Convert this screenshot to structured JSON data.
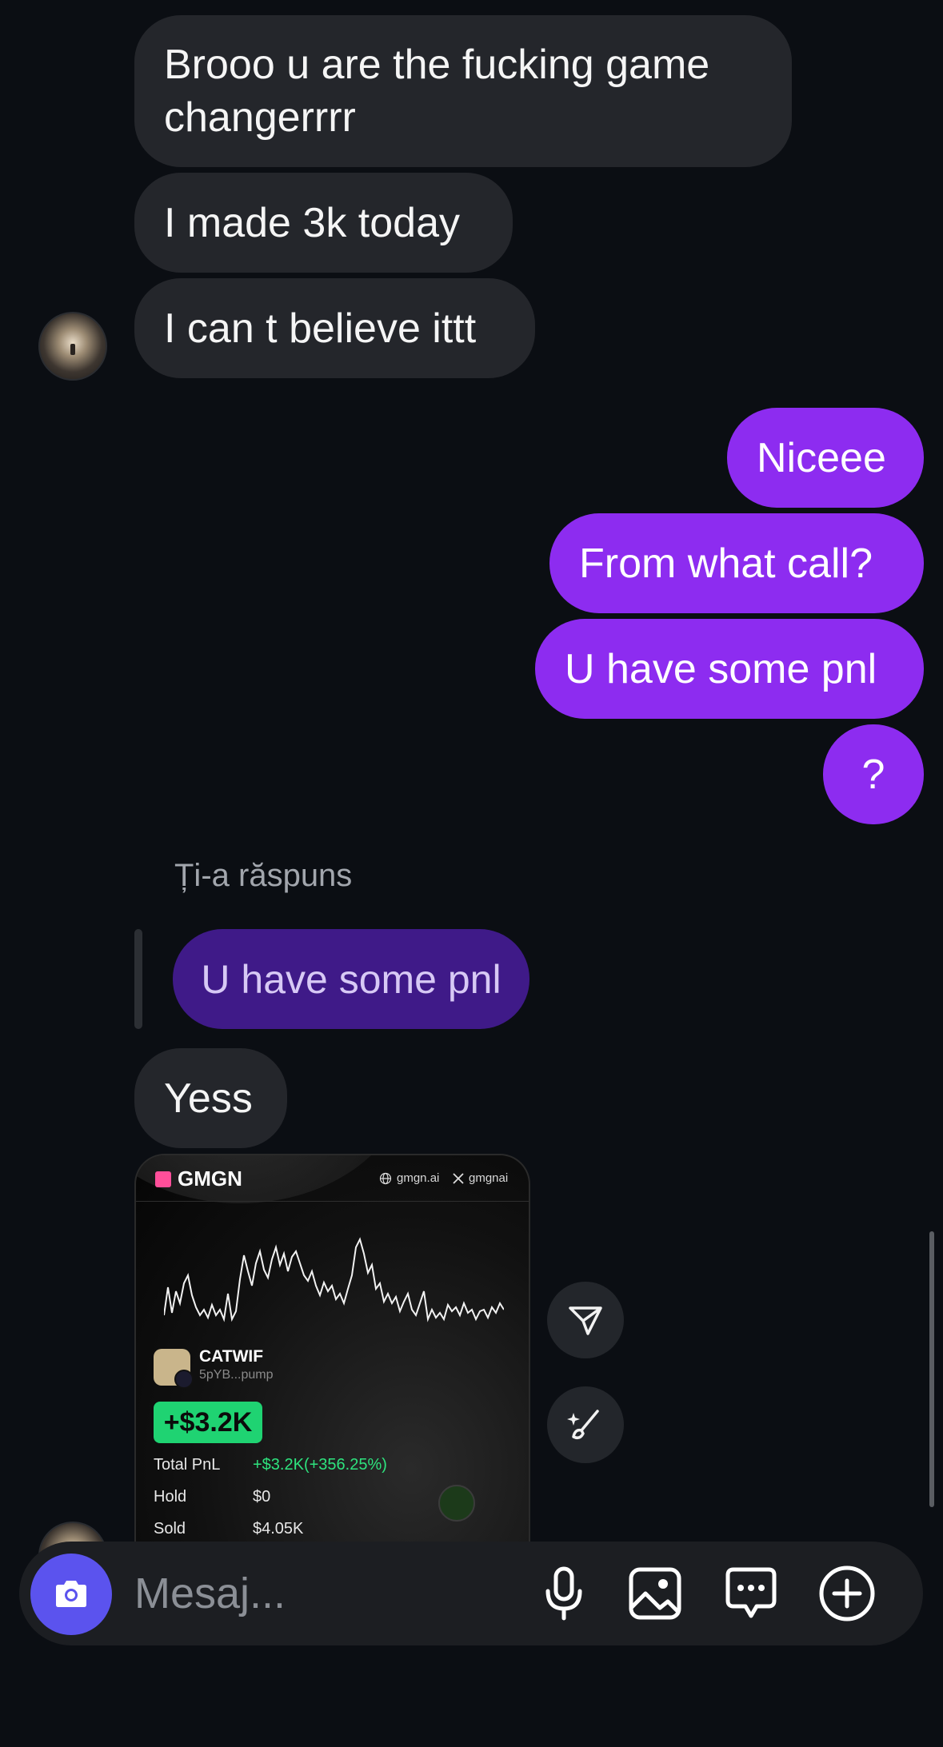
{
  "messages": {
    "m1": "Brooo u are the fucking game changerrrr",
    "m2": "I made 3k today",
    "m3": "I can t believe ittt",
    "o1": "Niceee",
    "o2": "From what call?",
    "o3": "U have some pnl",
    "o4": "?",
    "reply_label": "Ți-a răspuns",
    "reply_quote": "U have some pnl",
    "m4": "Yess"
  },
  "card": {
    "brand": "GMGN",
    "site": "gmgn.ai",
    "handle": "gmgnai",
    "token_name": "CATWIF",
    "token_addr": "5pYB...pump",
    "big_value": "+$3.2K",
    "total_pnl_label": "Total PnL",
    "total_pnl_value": "+$3.2K(+356.25%)",
    "hold_label": "Hold",
    "hold_value": "$0",
    "sold_label": "Sold",
    "sold_value": "$4.05K",
    "accent_green": "#1fd372"
  },
  "composer": {
    "placeholder": "Mesaj..."
  },
  "icons": [
    "camera-icon",
    "microphone-icon",
    "image-icon",
    "chat-bubble-icon",
    "plus-circle-icon",
    "send-icon",
    "brush-sparkle-icon"
  ],
  "colors": {
    "outgoing": "#8d2cf0",
    "incoming": "#24262b",
    "reply": "#3f1a88",
    "camera": "#5b53ee"
  }
}
